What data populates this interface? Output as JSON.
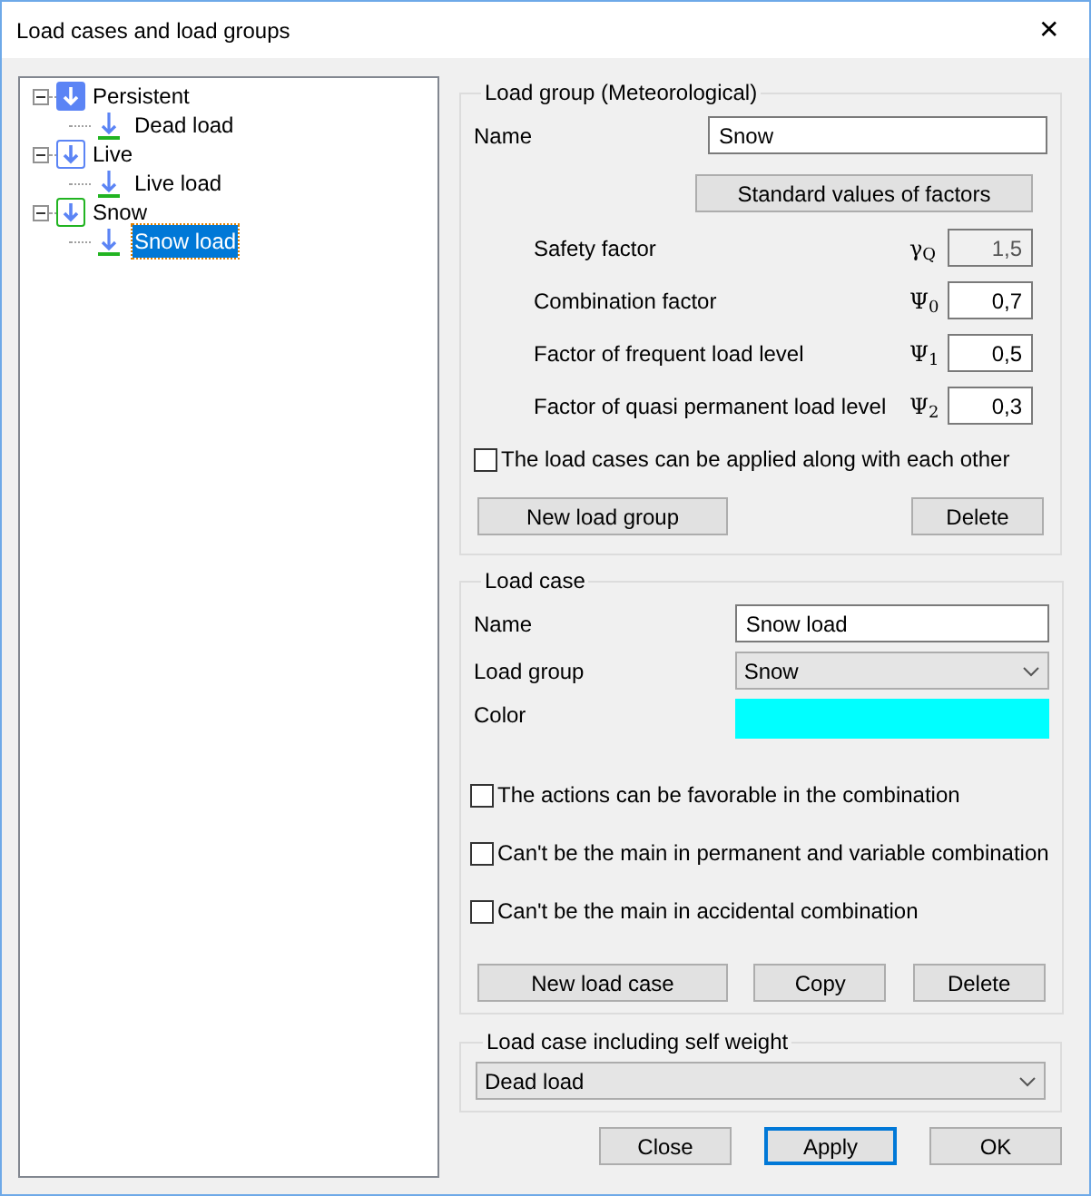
{
  "window": {
    "title": "Load cases and load groups",
    "close": "✕"
  },
  "tree": [
    {
      "label": "Persistent",
      "kind": "filled",
      "color": "#5b84f5",
      "expanded": true,
      "children": [
        {
          "label": "Dead load",
          "selected": false
        }
      ]
    },
    {
      "label": "Live",
      "kind": "outlined",
      "color": "#5b84f5",
      "expanded": true,
      "children": [
        {
          "label": "Live load",
          "selected": false
        }
      ]
    },
    {
      "label": "Snow",
      "kind": "outlined",
      "color": "#22b422",
      "expanded": true,
      "children": [
        {
          "label": "Snow load",
          "selected": true
        }
      ]
    }
  ],
  "load_group": {
    "legend": "Load group (Meteorological)",
    "name_label": "Name",
    "name_value": "Snow",
    "standard_button": "Standard values of factors",
    "factors": [
      {
        "label": "Safety factor",
        "symbol": "γ$_{Q}$",
        "value": "1,5",
        "disabled": true
      },
      {
        "label": "Combination factor",
        "symbol": "Ψ$_{0}$",
        "value": "0,7",
        "disabled": false
      },
      {
        "label": "Factor of frequent load level",
        "symbol": "Ψ$_{1}$",
        "value": "0,5",
        "disabled": false
      },
      {
        "label": "Factor of quasi permanent load level",
        "symbol": "Ψ$_{2}$",
        "value": "0,3",
        "disabled": false
      }
    ],
    "checkbox": {
      "label": "The load cases can be applied along with each other",
      "checked": false
    },
    "buttons": [
      "New load group",
      "Delete"
    ]
  },
  "load_case": {
    "legend": "Load case",
    "name_label": "Name",
    "name_value": "Snow load",
    "group_label": "Load group",
    "group_value": "Snow",
    "color_label": "Color",
    "color": "#00ffff",
    "checkboxes": [
      {
        "label": "The actions can be favorable in the combination",
        "checked": false
      },
      {
        "label": "Can't be the main in permanent and variable combination",
        "checked": false
      },
      {
        "label": "Can't be the main in accidental combination",
        "checked": false
      }
    ],
    "buttons": [
      "New load case",
      "Copy",
      "Delete"
    ]
  },
  "self_weight": {
    "legend": "Load case including self weight",
    "value": "Dead load"
  },
  "footer_buttons": [
    {
      "label": "Close",
      "selected": false
    },
    {
      "label": "Apply",
      "selected": true
    },
    {
      "label": "OK",
      "selected": false
    }
  ]
}
